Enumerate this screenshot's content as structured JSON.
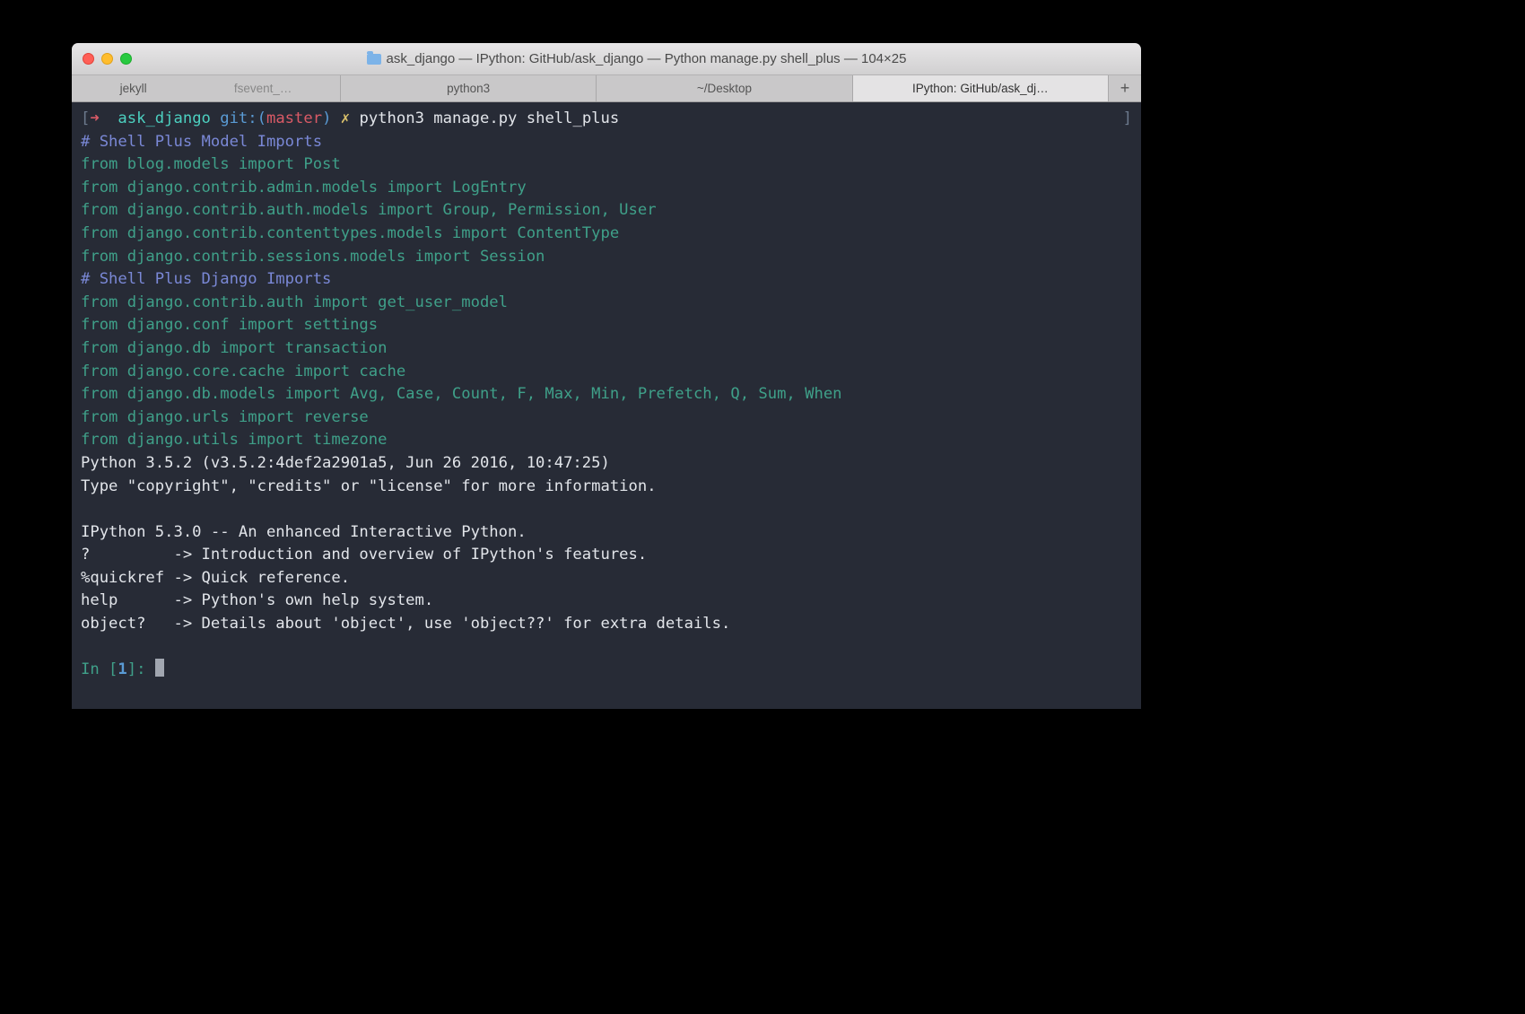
{
  "window": {
    "title": "ask_django — IPython: GitHub/ask_django — Python manage.py shell_plus — 104×25"
  },
  "tabs": {
    "group": [
      "jekyll",
      "fsevent_…"
    ],
    "t1": "python3",
    "t2": "~/Desktop",
    "t3": "IPython: GitHub/ask_dj…",
    "add": "+"
  },
  "prompt": {
    "lb": "[",
    "arrow": "➜  ",
    "dir": "ask_django",
    "git_pre": " git:(",
    "branch": "master",
    "git_post": ")",
    "dirty": " ✗",
    "cmd": " python3 manage.py shell_plus",
    "rb": "]"
  },
  "lines": {
    "c1": "# Shell Plus Model Imports",
    "i1": "from blog.models import Post",
    "i2": "from django.contrib.admin.models import LogEntry",
    "i3": "from django.contrib.auth.models import Group, Permission, User",
    "i4": "from django.contrib.contenttypes.models import ContentType",
    "i5": "from django.contrib.sessions.models import Session",
    "c2": "# Shell Plus Django Imports",
    "i6": "from django.contrib.auth import get_user_model",
    "i7": "from django.conf import settings",
    "i8": "from django.db import transaction",
    "i9": "from django.core.cache import cache",
    "i10": "from django.db.models import Avg, Case, Count, F, Max, Min, Prefetch, Q, Sum, When",
    "i11": "from django.urls import reverse",
    "i12": "from django.utils import timezone",
    "p1": "Python 3.5.2 (v3.5.2:4def2a2901a5, Jun 26 2016, 10:47:25)",
    "p2": "Type \"copyright\", \"credits\" or \"license\" for more information.",
    "blank": "",
    "p3": "IPython 5.3.0 -- An enhanced Interactive Python.",
    "p4": "?         -> Introduction and overview of IPython's features.",
    "p5": "%quickref -> Quick reference.",
    "p6": "help      -> Python's own help system.",
    "p7": "object?   -> Details about 'object', use 'object??' for extra details."
  },
  "in_prompt": {
    "pre": "In [",
    "num": "1",
    "post": "]: "
  }
}
